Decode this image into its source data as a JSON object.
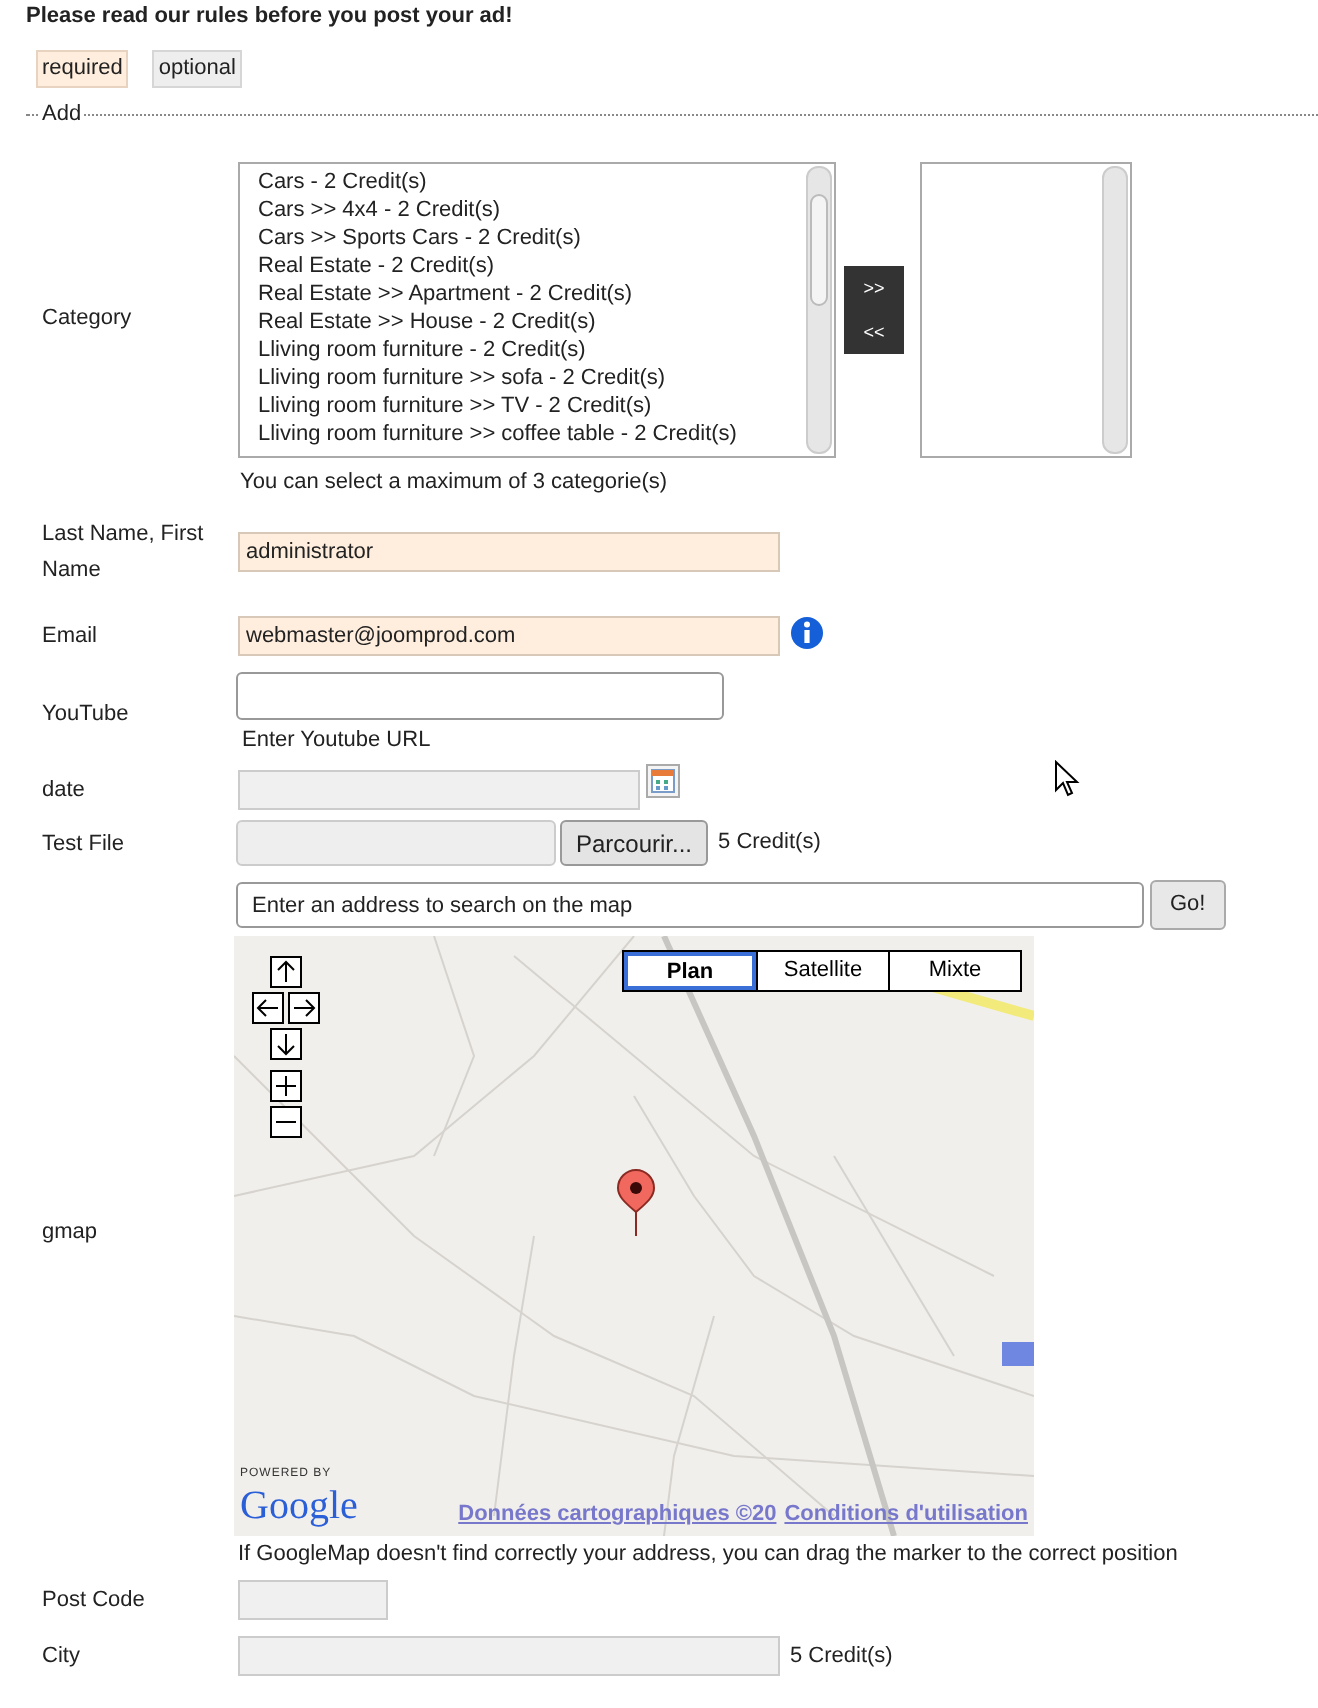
{
  "notice": "Please read our rules before you post your ad!",
  "legend": [
    {
      "label": "required",
      "kind": "required"
    },
    {
      "label": "optional",
      "kind": "optional"
    }
  ],
  "section_title": "Add",
  "fields": [
    {
      "kind": "category",
      "label": "Category",
      "options": [
        "Cars - 2 Credit(s)",
        "Cars >> 4x4 - 2 Credit(s)",
        "Cars >> Sports Cars - 2 Credit(s)",
        "Real Estate - 2 Credit(s)",
        "Real Estate >> Apartment - 2 Credit(s)",
        "Real Estate >> House - 2 Credit(s)",
        "Lliving room furniture - 2 Credit(s)",
        "Lliving room furniture >> sofa - 2 Credit(s)",
        "Lliving room furniture >> TV - 2 Credit(s)",
        "Lliving room furniture >> coffee table - 2 Credit(s)"
      ],
      "buttons": [
        ">>",
        "<<"
      ],
      "hint": "You can select a maximum of 3 categorie(s)"
    },
    {
      "kind": "text",
      "label": "Last Name, First Name",
      "value": "administrator",
      "required": true,
      "info": false
    },
    {
      "kind": "text",
      "label": "Email",
      "value": "webmaster@joomprod.com",
      "required": true,
      "info": true
    },
    {
      "kind": "url",
      "label": "YouTube",
      "hint": "Enter Youtube URL"
    },
    {
      "kind": "date",
      "label": "date"
    },
    {
      "kind": "file",
      "label": "Test File",
      "button": "Parcourir...",
      "credits": "5 Credit(s)"
    },
    {
      "kind": "map",
      "label": "gmap",
      "placeholder": "Enter an address to search on the map",
      "button": "Go!",
      "map_types": [
        {
          "label": "Plan",
          "selected": true
        },
        {
          "label": "Satellite",
          "selected": false
        },
        {
          "label": "Mixte",
          "selected": false
        }
      ],
      "powered_by": "POWERED BY",
      "logo": "Google",
      "links": [
        "Données cartographiques ©20",
        "Conditions d'utilisation"
      ],
      "hint": "If GoogleMap doesn't find correctly your address, you can drag the marker to the correct position"
    },
    {
      "kind": "text",
      "label": "Post Code",
      "required": false,
      "info": false,
      "short": true
    },
    {
      "kind": "text",
      "label": "City",
      "required": false,
      "info": false,
      "short": false,
      "credits": "5 Credit(s)"
    }
  ]
}
